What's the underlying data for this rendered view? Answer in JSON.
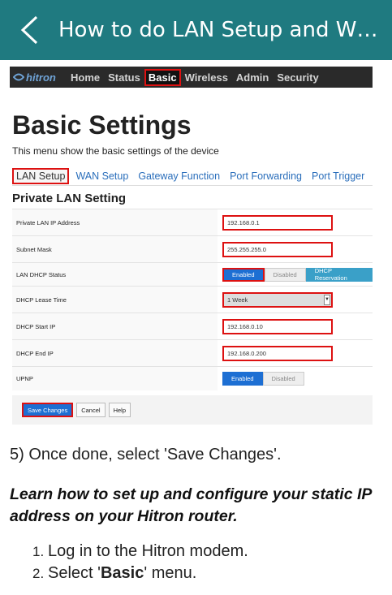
{
  "appbar": {
    "title": "How to do LAN Setup and WAN Setup"
  },
  "router": {
    "logo": "hitron",
    "nav": [
      "Home",
      "Status",
      "Basic",
      "Wireless",
      "Admin",
      "Security"
    ],
    "heading": "Basic Settings",
    "subtitle": "This menu show the basic settings of the device",
    "tabs": [
      "LAN Setup",
      "WAN Setup",
      "Gateway Function",
      "Port Forwarding",
      "Port Trigger"
    ],
    "section": "Private LAN Setting",
    "rows": [
      {
        "label": "Private LAN IP Address",
        "value": "192.168.0.1"
      },
      {
        "label": "Subnet Mask",
        "value": "255.255.255.0"
      },
      {
        "label": "LAN DHCP Status",
        "options": [
          "Enabled",
          "Disabled",
          "DHCP Reservation"
        ]
      },
      {
        "label": "DHCP Lease Time",
        "value": "1 Week"
      },
      {
        "label": "DHCP Start IP",
        "value": "192.168.0.10"
      },
      {
        "label": "DHCP End IP",
        "value": "192.168.0.200"
      },
      {
        "label": "UPNP",
        "options": [
          "Enabled",
          "Disabled"
        ]
      }
    ],
    "actions": [
      "Save Changes",
      "Cancel",
      "Help"
    ]
  },
  "article": {
    "step5": "5) Once done, select 'Save Changes'.",
    "heading": "Learn how to set up and configure your static IP address on your Hitron router.",
    "steps": [
      {
        "num": "1.",
        "text": "Log in to the Hitron modem."
      },
      {
        "num": "2.",
        "pre": "Select '",
        "bold": "Basic",
        "post": "' menu."
      }
    ]
  },
  "colors": {
    "appbar": "#1f7a80",
    "highlight": "#dd1111",
    "button_blue": "#1d6fd3",
    "link": "#2a6ebb"
  }
}
